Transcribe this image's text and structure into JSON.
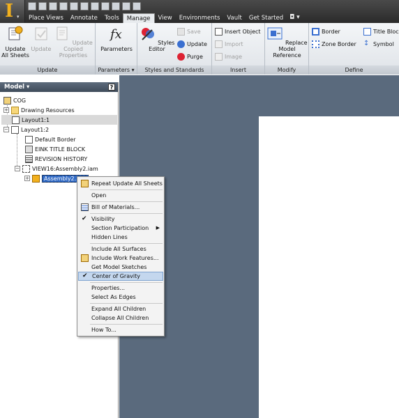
{
  "app": {
    "logo_letter": "I",
    "logo_badge": "▾"
  },
  "menu": {
    "tabs": [
      "Place Views",
      "Annotate",
      "Tools",
      "Manage",
      "View",
      "Environments",
      "Vault",
      "Get Started"
    ],
    "active": "Manage",
    "extra": "◘ ▾"
  },
  "ribbon": {
    "groups": {
      "update": "Update",
      "parameters": "Parameters ▾",
      "styles": "Styles and Standards",
      "insert": "Insert",
      "modify": "Modify",
      "define": "Define"
    },
    "buttons": {
      "update_all": "Update All Sheets",
      "update": "Update",
      "update_copied": "Update Copied Properties",
      "parameters": "Parameters",
      "styles_editor": "Styles Editor",
      "save": "Save",
      "update_small": "Update",
      "purge": "Purge",
      "insert_object": "Insert Object",
      "import": "Import",
      "image": "Image",
      "replace_model": "Replace Model Reference",
      "border": "Border",
      "zone_border": "Zone Border",
      "title_block": "Title Block",
      "symbol": "Symbol"
    }
  },
  "browser": {
    "title": "Model ▾",
    "help": "?",
    "tree": {
      "root": "COG",
      "drawing_resources": "Drawing Resources",
      "layout1": "Layout1:1",
      "layout2": "Layout1:2",
      "default_border": "Default Border",
      "title_block": "EINK TITLE BLOCK",
      "revision": "REVISION HISTORY",
      "view": "VIEW16:Assembly2.iam",
      "assembly": "Assembly2.iam"
    }
  },
  "context_menu": {
    "items": {
      "repeat": "Repeat Update All Sheets",
      "open": "Open",
      "bom": "Bill of Materials...",
      "visibility": "Visibility",
      "section": "Section Participation",
      "hidden": "Hidden Lines",
      "surfaces": "Include All Surfaces",
      "work": "Include Work Features...",
      "sketches": "Get Model Sketches",
      "cog": "Center of Gravity",
      "properties": "Properties...",
      "edges": "Select As Edges",
      "expand": "Expand All Children",
      "collapse": "Collapse All Children",
      "howto": "How To..."
    }
  },
  "colors": {
    "accent": "#f2b01e",
    "canvas": "#5a6a7d",
    "highlight": "#c4d7ee"
  }
}
